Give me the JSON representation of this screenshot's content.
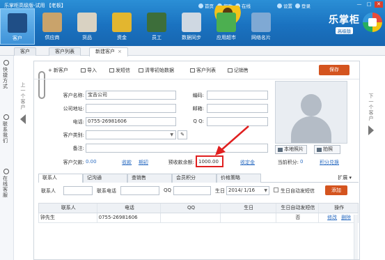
{
  "window": {
    "title": "乐掌柜高级版-试用 【老板】",
    "sys_menu": [
      "首页",
      "帮助",
      "在线",
      "设置",
      "登录"
    ],
    "buttons": [
      "—",
      "□",
      "✕"
    ]
  },
  "nav": {
    "items": [
      {
        "label": "客户",
        "icon": "customer-icon"
      },
      {
        "label": "供应商",
        "icon": "supplier-icon"
      },
      {
        "label": "货品",
        "icon": "goods-icon"
      },
      {
        "label": "资金",
        "icon": "money-icon"
      },
      {
        "label": "员工",
        "icon": "staff-icon"
      },
      {
        "label": "数据同步",
        "icon": "sync-icon"
      },
      {
        "label": "应用超市",
        "icon": "app-store-icon"
      },
      {
        "label": "网络名片",
        "icon": "card-icon"
      }
    ],
    "active_index": 0
  },
  "brand": {
    "name": "乐掌柜",
    "edition": "高级版"
  },
  "tabs": [
    {
      "label": "客户"
    },
    {
      "label": "客户列表"
    },
    {
      "label": "新建客户",
      "close": "×"
    }
  ],
  "sidebar": {
    "items": [
      {
        "label": "快捷方式"
      },
      {
        "label": "联系我们"
      },
      {
        "label": "在线客服"
      }
    ]
  },
  "prev_label": "上一个客户",
  "next_label": "下一个客户",
  "toolbar": {
    "new": "新客户",
    "import": "导入",
    "sms": "发短信",
    "opening": "清零初始数据",
    "list": "客户列表",
    "record": "记销售",
    "save": "保存"
  },
  "form": {
    "name_label": "客户名称:",
    "name_value": "宝吉公司",
    "address_label": "公司地址:",
    "phone_label": "电话:",
    "phone_value": "0755-26981606",
    "category_label": "客户类别:",
    "remark_label": "备注:",
    "code_label": "编码:",
    "email_label": "邮箱:",
    "qq_label": "Q Q:",
    "debt_label": "客户欠款:",
    "debt_value": "0.00",
    "debt_link1": "收款",
    "debt_link2": "期初",
    "prepaid_label": "预收款余额:",
    "prepaid_value": "1000.00",
    "prepaid_link": "收定金",
    "points_label": "当前积分:",
    "points_value": "0",
    "points_link": "积分兑换"
  },
  "photo_buttons": {
    "local": "本地照片",
    "shoot": "拍照"
  },
  "subtabs": {
    "items": [
      "联系人",
      "记沟通",
      "查销售",
      "会员积分",
      "价格策略"
    ],
    "expand": "扩展"
  },
  "contact_form": {
    "name_label": "联系人",
    "phone_label": "联系电话",
    "qq_label": "QQ",
    "birthday_label": "生日",
    "birthday_value": "2014/ 1/16",
    "remind_label": "生日自动发短信",
    "add_button": "添加"
  },
  "grid": {
    "headers": [
      "联系人",
      "电话",
      "QQ",
      "生日",
      "生日自动发短信",
      "操作"
    ],
    "rows": [
      {
        "name": "钟先生",
        "phone": "0755-26981606",
        "qq": "",
        "birthday": "",
        "remind": "否",
        "edit": "修改",
        "delete": "删除"
      }
    ]
  },
  "colors": {
    "topbar": "#1a72c0",
    "accent_orange": "#d4541f",
    "link_blue": "#2f6fc3",
    "highlight_red": "#e02020"
  }
}
